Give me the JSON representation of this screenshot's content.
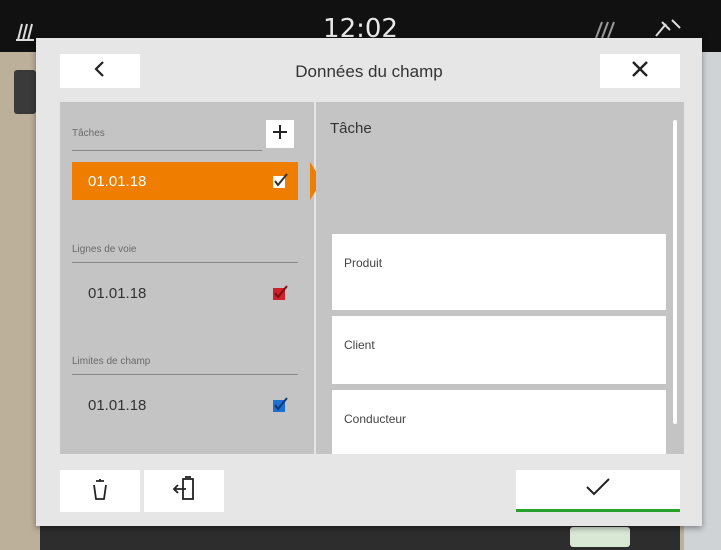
{
  "statusbar": {
    "time": "12:02"
  },
  "dialog": {
    "title": "Données du champ",
    "left": {
      "tasks_section": {
        "label": "Tâches",
        "items": [
          {
            "label": "01.01.18",
            "selected": true,
            "check_color": "#ffffff"
          }
        ]
      },
      "tracklines_section": {
        "label": "Lignes de voie",
        "items": [
          {
            "label": "01.01.18",
            "check_color": "#d0202a"
          }
        ]
      },
      "boundaries_section": {
        "label": "Limites de champ",
        "items": [
          {
            "label": "01.01.18",
            "check_color": "#1f6fd0"
          }
        ]
      }
    },
    "right": {
      "heading": "Tâche",
      "fields": [
        {
          "label": "Produit"
        },
        {
          "label": "Client"
        },
        {
          "label": "Conducteur"
        }
      ]
    }
  },
  "colors": {
    "accent": "#ef7d00",
    "confirm_underline": "#2aa12a",
    "panel": "#c4c4c4",
    "dialog_bg": "#e6e6e6"
  },
  "icons": {
    "back": "chevron-left-icon",
    "close": "close-icon",
    "add": "plus-icon",
    "delete": "trash-icon",
    "export": "export-icon",
    "confirm": "checkmark-icon"
  }
}
